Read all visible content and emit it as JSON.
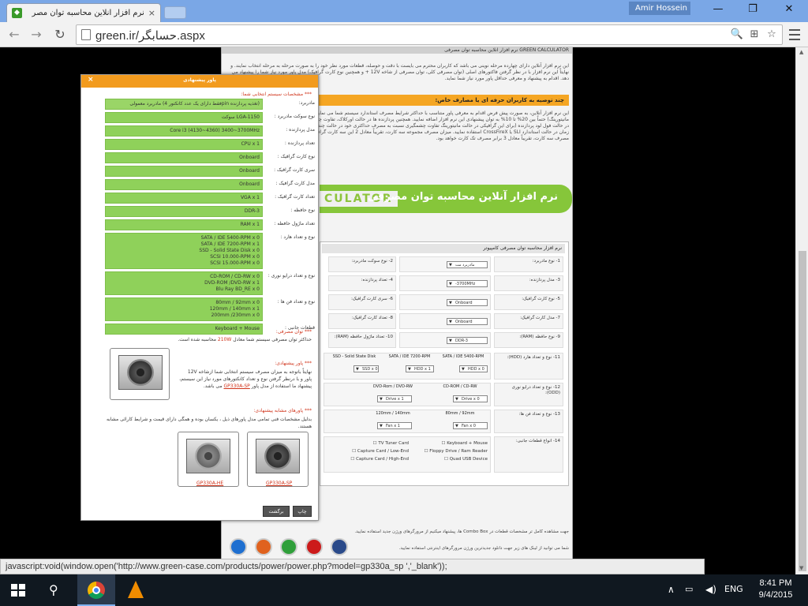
{
  "browser": {
    "tab_title": "نرم افزار آنلاین محاسبه توان مصر",
    "favicon": "◆",
    "tab_close": "×",
    "profile_name": "Amir Hossein",
    "minimize": "—",
    "maximize": "❐",
    "close": "✕",
    "back": "←",
    "forward": "→",
    "reload": "↻",
    "url": "green.ir/حسابگر.aspx",
    "zoom_icon": "🔍",
    "translate_icon": "⊞",
    "star_icon": "☆",
    "status_url": "javascript:void(window.open('http://www.green-case.com/products/power/power.php?model=gp330a_sp                                       ','_blank'));"
  },
  "page": {
    "header_text": "نرم افزار آنلاین محاسبه توان مصرفی GREEN CALCULATOR",
    "intro": "این نرم افزار آنلاین دارای چهارده مرحله نوینی می باشد که کاربران محترم می بایست با دقت و حوصله، قطعات مورد نظر خود را به صورت مرحله به مرحله انتخاب نمایند. و نهایتاً این نرم افزار با در نظر گرفتن فاکتورهای اصلی (توان مصرفی کلی، توان مصرفی از شاخه 12V + و همچنین نوع کارت گرافیک) مدل پاور مورد نیاز شما را پیشنهاد می دهد. اقدام به پیشنهاد و معرفی حداقل پاور مورد نیاز شما نماید.",
    "orange_bar": "چند توصیه به کاربران حرفه ای یا مصارف خاص:",
    "body2": "این نرم افزار آنلاین، به صورت پیش فرض اقدام به معرفی پاور متناسب با حداکثر شرایط مصرف استاندارد سیستم شما می نماید. از سیستم خود (مانند اورکلاکینگ و مانیتورینگ) حتماً بین 20% تا 10% به توان پیشنهادی این نرم افزار اضافه نمایید. همچنین پردازنده ها در حالت اورکلاک، تفاوت چشمگیری نسبت به توان مصرفی حداکثری خود در حالت فول لود پردازنده (برای این گرافیکی در حالت مانیتورینگ تفاوت چشمگیری نسبت به مصرف حداکثری خود در حالت چندگانه (مانند SLI, CrossFireX) به صورت هم زمان در حالت استاندارد SLI یا CrossFireX استفاده نمایید. میزان مصرف مجموعه سه کارت، تقریباً معادل 2 این سه کارت گرافیک، در حالت مانیتورینگ استفاده شود، میزان مصرف سه کارت، تقریباً معادل 3 برابر مصرف تک کارت خواهد بود.",
    "banner_fa": "نرم افزار آنلاین محاسبه توان مصرفی",
    "banner_en": "CULATOR",
    "form_title": "نرم افزار محاسبه توان مصرفی کامپیوتر",
    "form_rows": [
      {
        "l1": "1- نوع مادربرد:",
        "s1": "مادربرد مت",
        "l2": "2- نوع سوکت مادربرد:"
      },
      {
        "l1": "3- مدل پردازنده:",
        "s1": "-3700MHz",
        "l2": "4- تعداد پردازنده:"
      },
      {
        "l1": "5- نوع کارت گرافیک:",
        "s1": "Onboard",
        "l2": "6- سری کارت گرافیک:"
      },
      {
        "l1": "7- مدل کارت گرافیک:",
        "s1": "Onboard",
        "l2": "8- تعداد کارت گرافیک:"
      },
      {
        "l1": "9- نوع حافظه (RAM):",
        "s1": "DDR-3",
        "l2": "10- تعداد ماژول حافظه (RAM):"
      }
    ],
    "hdd_label": "11- نوع و تعداد هارد (HDD):",
    "hdd_cols": [
      "SATA / IDE 5400-RPM",
      "SATA / IDE 7200-RPM",
      "SSD - Solid State Disk"
    ],
    "hdd_vals": [
      "HDD x 0",
      "HDD x 1",
      "SSD x 0"
    ],
    "odd_label": "12- نوع و تعداد درایو نوری (ODD):",
    "odd_cols": [
      "CD-ROM / CD-RW",
      "DVD-Rom / DVD-RW"
    ],
    "odd_vals": [
      "Drive x 0",
      "Drive x 1"
    ],
    "fan_label": "13- نوع و تعداد فن ها:",
    "fan_cols": [
      "80mm / 92mm",
      "120mm / 140mm"
    ],
    "fan_vals": [
      "Fan x 0",
      "Fan x 1"
    ],
    "misc_label": "14- انواع قطعات جانبی:",
    "misc_right": [
      "Keyboard + Mouse",
      "Floppy Drive / Ram Reader",
      "Quad USB Device"
    ],
    "misc_left": [
      "TV Tuner Card",
      "Capture Card / Low-End",
      "Capture Card / High-End"
    ],
    "footer1": "جهت مشاهده کامل تر مشخصات قطعات در Combo Box ها، پیشنهاد میکنیم از مرورگرهای ورژن جدید استفاده نمایید.",
    "footer2": "شما می توانید از لینک های زیر جهت دانلود جدیدترین ورژن مرورگرهای اینترنتی استفاده نمایید."
  },
  "popup": {
    "title": "پاور پیشنهادی",
    "close": "×",
    "specs_title": "*** مشخصات سیستم انتخابی شما:",
    "rows": [
      {
        "label": "مادربرد:",
        "lines": [
          "مادربرد معمولی (فقط دارای یک عدد کانکتور 4pin تغذیه پردازنده)"
        ]
      },
      {
        "label": "نوع سوکت مادربرد :",
        "lines": [
          "سوکت LGA-1150"
        ]
      },
      {
        "label": "مدل پردازنده :",
        "lines": [
          "Core i3 (4130~4360) 3400~3700MHz"
        ]
      },
      {
        "label": "تعداد پردازنده :",
        "lines": [
          "CPU x 1"
        ]
      },
      {
        "label": "نوع کارت گرافیک :",
        "lines": [
          "Onboard"
        ]
      },
      {
        "label": "سری کارت گرافیک :",
        "lines": [
          "Onboard"
        ]
      },
      {
        "label": "مدل کارت گرافیک :",
        "lines": [
          "Onboard"
        ]
      },
      {
        "label": "تعداد کارت گرافیک :",
        "lines": [
          "VGA x 1"
        ]
      },
      {
        "label": "نوع حافظه :",
        "lines": [
          "DDR-3"
        ]
      },
      {
        "label": "تعداد ماژول حافظه :",
        "lines": [
          "RAM x 1"
        ]
      },
      {
        "label": "نوع و تعداد هارد :",
        "lines": [
          "SATA / IDE 5400-RPM x 0",
          "SATA / IDE 7200-RPM x 1",
          "SSD - Solid State Disk x 0",
          "SCSI 10.000-RPM x 0",
          "SCSI 15.000-RPM x 0"
        ]
      },
      {
        "label": "نوع و تعداد درایو نوری :",
        "lines": [
          "CD-ROM / CD-RW x 0",
          "DVD-ROM /DVD-RW x 1",
          "Blu Ray BD_RE x 0"
        ]
      },
      {
        "label": "نوع و تعداد فن ها :",
        "lines": [
          "80mm / 92mm x 0",
          "120mm / 140mm x 1",
          "200mm /230mm x 0"
        ]
      },
      {
        "label": "قطعات جانبی :",
        "lines": [
          "Keyboard + Mouse"
        ]
      }
    ],
    "power_title": "*** توان مصرفی:",
    "power_text_a": "حداکثر توان مصرفی سیستم شما معادل",
    "power_value": "210W",
    "power_text_b": "محاسبه شده است.",
    "suggest_title": "*** پاور پیشنهادی:",
    "suggest_text": "نهایتاً باتوجه به میزان مصرف سیستم انتخابی شما ازشاخه 12V پاور و با درنظر گرفتن نوع و تعداد کانکتورهای مورد نیاز این سیستم، پیشنهاد ما استفاده از مدل پاور",
    "suggest_model": "GP330A-SP",
    "suggest_tail": "می باشد.",
    "similar_title": "*** پاورهای مشابه پیشنهادی:",
    "similar_text": "بدلیل مشخصات فنی تمامی مدل پاورهای ذیل ، یکسان بوده و همگی دارای قیمت و شرایط کارائی مشابه هستند.",
    "similar": [
      "GP330A-SP",
      "GP330A-HE"
    ],
    "btn_back": "برگشت",
    "btn_print": "چاپ"
  },
  "taskbar": {
    "search_icon": "⚲",
    "up_arrow": "∧",
    "lang": "ENG",
    "time": "8:41 PM",
    "date": "9/4/2015"
  }
}
